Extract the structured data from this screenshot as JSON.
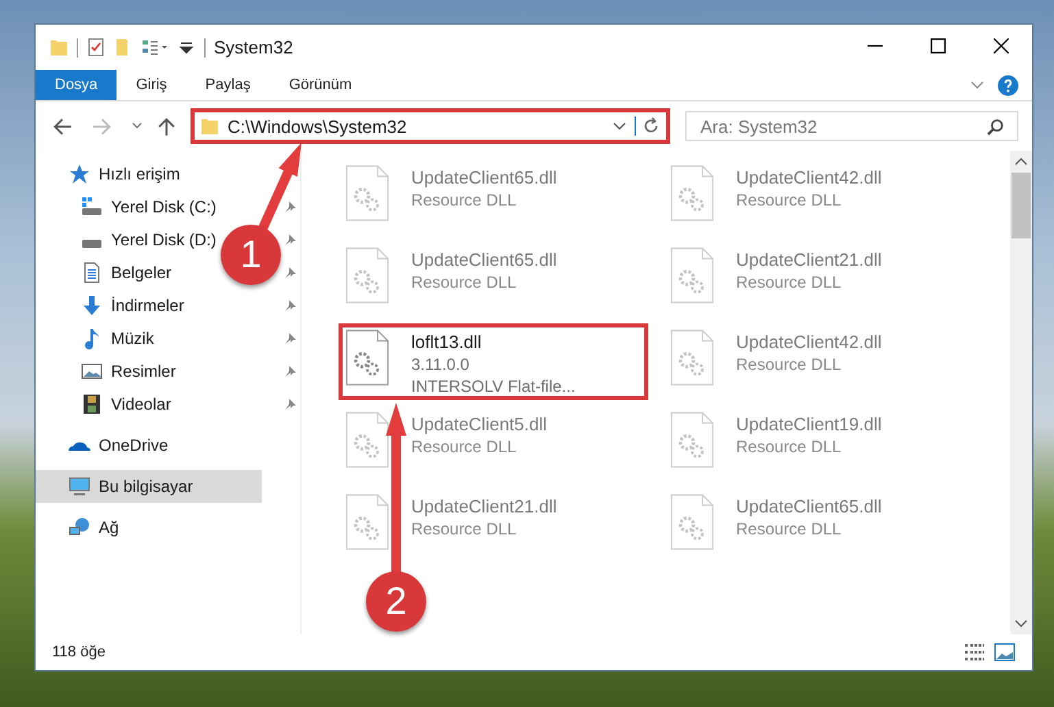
{
  "window": {
    "title": "System32"
  },
  "ribbon_tabs": [
    {
      "label": "Dosya",
      "selected": true
    },
    {
      "label": "Giriş",
      "selected": false
    },
    {
      "label": "Paylaş",
      "selected": false
    },
    {
      "label": "Görünüm",
      "selected": false
    }
  ],
  "address_bar": {
    "path": "C:\\Windows\\System32",
    "highlighted": true
  },
  "search": {
    "placeholder": "Ara: System32"
  },
  "sidebar": {
    "items": [
      {
        "label": "Hızlı erişim",
        "selected": false,
        "children": [
          {
            "label": "Yerel Disk (C:)",
            "pinned": true
          },
          {
            "label": "Yerel Disk (D:)",
            "pinned": true
          },
          {
            "label": "Belgeler",
            "pinned": true
          },
          {
            "label": "İndirmeler",
            "pinned": true
          },
          {
            "label": "Müzik",
            "pinned": true
          },
          {
            "label": "Resimler",
            "pinned": true
          },
          {
            "label": "Videolar",
            "pinned": true
          }
        ]
      },
      {
        "label": "OneDrive",
        "selected": false
      },
      {
        "label": "Bu bilgisayar",
        "selected": true
      },
      {
        "label": "Ağ",
        "selected": false
      }
    ]
  },
  "files": [
    {
      "name": "UpdateClient65.dll",
      "lines": [
        "Resource DLL"
      ],
      "dimmed": true,
      "highlighted": false
    },
    {
      "name": "UpdateClient42.dll",
      "lines": [
        "Resource DLL"
      ],
      "dimmed": true,
      "highlighted": false
    },
    {
      "name": "UpdateClient65.dll",
      "lines": [
        "Resource DLL"
      ],
      "dimmed": true,
      "highlighted": false
    },
    {
      "name": "UpdateClient21.dll",
      "lines": [
        "Resource DLL"
      ],
      "dimmed": true,
      "highlighted": false
    },
    {
      "name": "loflt13.dll",
      "lines": [
        "3.11.0.0",
        "INTERSOLV Flat-file..."
      ],
      "dimmed": false,
      "highlighted": true
    },
    {
      "name": "UpdateClient42.dll",
      "lines": [
        "Resource DLL"
      ],
      "dimmed": true,
      "highlighted": false
    },
    {
      "name": "UpdateClient5.dll",
      "lines": [
        "Resource DLL"
      ],
      "dimmed": true,
      "highlighted": false
    },
    {
      "name": "UpdateClient19.dll",
      "lines": [
        "Resource DLL"
      ],
      "dimmed": true,
      "highlighted": false
    },
    {
      "name": "UpdateClient21.dll",
      "lines": [
        "Resource DLL"
      ],
      "dimmed": true,
      "highlighted": false
    },
    {
      "name": "UpdateClient65.dll",
      "lines": [
        "Resource DLL"
      ],
      "dimmed": true,
      "highlighted": false
    }
  ],
  "status_bar": {
    "item_count": "118 öğe"
  },
  "annotations": [
    {
      "label": "1"
    },
    {
      "label": "2"
    }
  ]
}
